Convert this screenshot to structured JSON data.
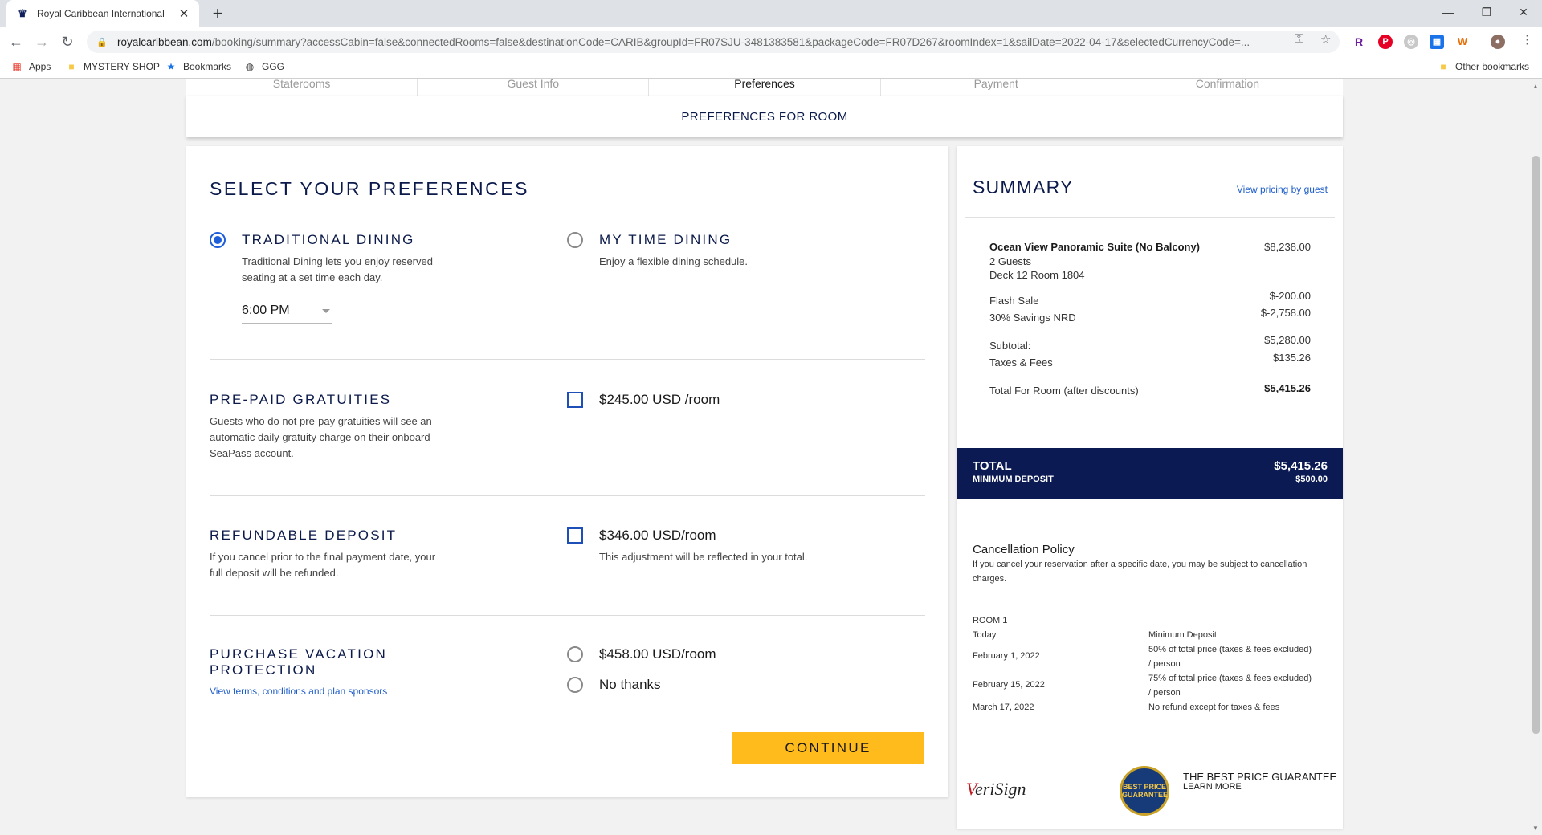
{
  "browser": {
    "tab_title": "Royal Caribbean International",
    "url_host": "royalcaribbean.com",
    "url_path": "/booking/summary?accessCabin=false&connectedRooms=false&destinationCode=CARIB&groupId=FR07SJU-3481383581&packageCode=FR07D267&roomIndex=1&sailDate=2022-04-17&selectedCurrencyCode=...",
    "bookmarks": [
      "Apps",
      "MYSTERY SHOP",
      "Bookmarks",
      "GGG"
    ],
    "other_bookmarks": "Other bookmarks"
  },
  "steps": [
    "Staterooms",
    "Guest Info",
    "Preferences",
    "Payment",
    "Confirmation"
  ],
  "room_bar": "PREFERENCES FOR ROOM",
  "preferences": {
    "heading": "SELECT YOUR PREFERENCES",
    "traditional": {
      "title": "TRADITIONAL DINING",
      "desc_line1": "Traditional Dining lets you enjoy reserved",
      "desc_line2": "seating at a set time each day.",
      "time": "6:00 PM"
    },
    "mytime": {
      "title": "MY TIME DINING",
      "desc": "Enjoy a flexible dining schedule."
    },
    "gratuities": {
      "title": "PRE-PAID GRATUITIES",
      "desc_line1": "Guests who do not pre-pay gratuities will see an",
      "desc_line2": "automatic daily gratuity charge on their onboard",
      "desc_line3": "SeaPass account.",
      "price": "$245.00 USD /room"
    },
    "deposit": {
      "title": "REFUNDABLE DEPOSIT",
      "desc_line1": "If you cancel prior to the final payment date, your",
      "desc_line2": "full deposit will be refunded.",
      "price": "$346.00 USD/room",
      "note": "This adjustment will be reflected in your total."
    },
    "protection": {
      "title_line1": "PURCHASE VACATION",
      "title_line2": "PROTECTION",
      "link": "View terms, conditions and plan sponsors",
      "option_price": "$458.00 USD/room",
      "option_no": "No thanks"
    },
    "continue": "CONTINUE"
  },
  "summary": {
    "title": "SUMMARY",
    "pricing_link": "View pricing by guest",
    "room_name": "Ocean View Panoramic Suite (No Balcony)",
    "room_price": "$8,238.00",
    "guests": "2 Guests",
    "deck": "Deck 12 Room 1804",
    "flash_label": "Flash Sale",
    "flash_value": "$-200.00",
    "savings_label": "30% Savings NRD",
    "savings_value": "$-2,758.00",
    "subtotal_label": "Subtotal:",
    "subtotal_value": "$5,280.00",
    "taxes_label": "Taxes & Fees",
    "taxes_value": "$135.26",
    "room_total_label": "Total For Room (after discounts)",
    "room_total_value": "$5,415.26",
    "total_label": "TOTAL",
    "total_value": "$5,415.26",
    "deposit_label": "MINIMUM DEPOSIT",
    "deposit_value": "$500.00",
    "cancel_title": "Cancellation Policy",
    "cancel_desc": "If you cancel your reservation after a specific date, you may be subject to cancellation charges.",
    "cancel_room": "ROOM 1",
    "cancel_rows": [
      {
        "date": "Today",
        "policy_line1": "Minimum Deposit",
        "policy_line2": ""
      },
      {
        "date": "February 1, 2022",
        "policy_line1": "50% of total price (taxes & fees excluded)",
        "policy_line2": "/ person"
      },
      {
        "date": "February 15, 2022",
        "policy_line1": "75% of total price (taxes & fees excluded)",
        "policy_line2": "/ person"
      },
      {
        "date": "March 17, 2022",
        "policy_line1": "No refund except for taxes & fees",
        "policy_line2": ""
      }
    ],
    "verisign": "VeriSign",
    "badge_text": "BEST PRICE GUARANTEE",
    "bpg_title": "THE BEST PRICE GUARANTEE",
    "bpg_link": "LEARN MORE"
  }
}
